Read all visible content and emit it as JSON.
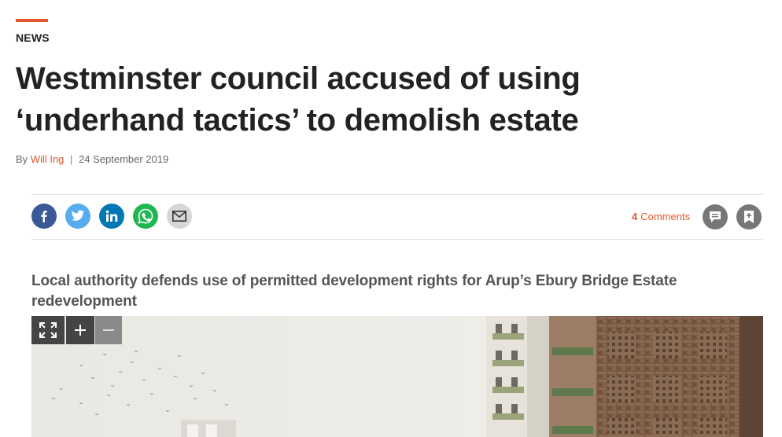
{
  "article": {
    "section": "NEWS",
    "headline": "Westminster council accused of using ‘underhand tactics’ to demolish estate",
    "byline": {
      "prefix": "By",
      "author": "Will Ing",
      "separator": "|",
      "date": "24 September 2019"
    },
    "standfirst": "Local authority defends use of permitted development rights for Arup’s Ebury Bridge Estate redevelopment"
  },
  "share": {
    "icons": [
      "facebook-icon",
      "twitter-icon",
      "linkedin-icon",
      "whatsapp-icon",
      "email-icon"
    ],
    "comments_count": "4",
    "comments_label": "Comments"
  },
  "image_controls": {
    "icons": [
      "fullscreen-icon",
      "zoom-in-icon",
      "zoom-out-icon"
    ]
  },
  "colors": {
    "accent": "#e2572c",
    "facebook": "#3b5998",
    "twitter": "#55acee",
    "linkedin": "#0077b5",
    "whatsapp": "#1fb752",
    "email": "#d7d7d7",
    "action_grey": "#777777"
  }
}
